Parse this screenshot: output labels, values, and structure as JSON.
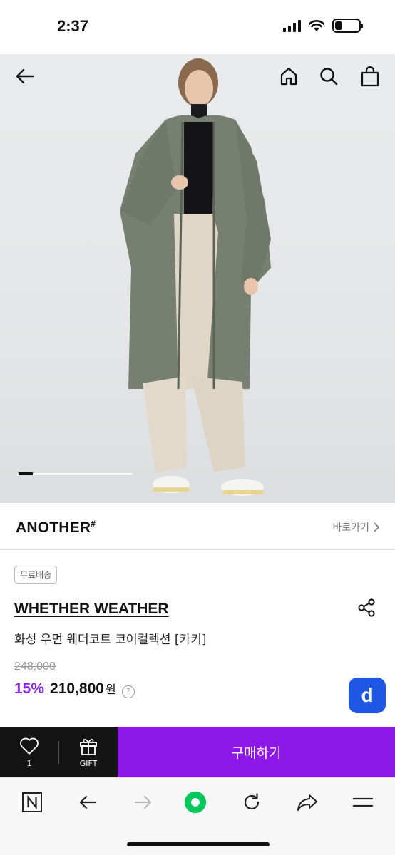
{
  "status_bar": {
    "time": "2:37"
  },
  "hero": {
    "page_index": 1
  },
  "brand": {
    "name": "ANOTHER",
    "mark": "#",
    "link_label": "바로가기"
  },
  "product": {
    "badge": "무료배송",
    "brand": "WHETHER WEATHER",
    "name": "화성 우먼 웨더코트 코어컬렉션 [카키]",
    "original_price": "248,000",
    "discount": "15%",
    "sale_price": "210,800",
    "currency": "원",
    "info_icon": "?",
    "app_badge": "d"
  },
  "actions": {
    "like_count": "1",
    "gift_label": "GIFT",
    "buy_label": "구매하기"
  },
  "colors": {
    "accent": "#8d16e8",
    "badge": "#1e57e4",
    "naver_green": "#03c75a"
  }
}
